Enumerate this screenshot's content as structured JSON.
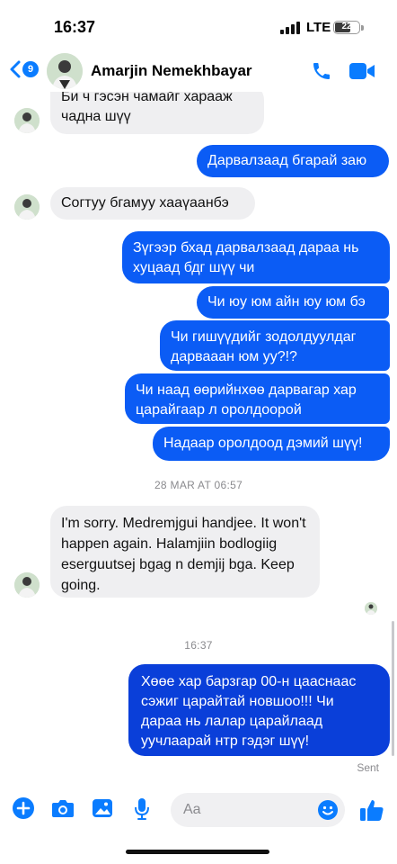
{
  "status_bar": {
    "time": "16:37",
    "network": "LTE",
    "battery": "22"
  },
  "header": {
    "back_count": "9",
    "contact_name": "Amarjin Nemekhbayar"
  },
  "messages": [
    {
      "side": "in",
      "text": "Би ч гэсэн чамайг харааж чадна шүү"
    },
    {
      "side": "out",
      "text": "Дарвалзаад бгарай заю"
    },
    {
      "side": "in",
      "text": "Согтуу бгамуу хааүаанбэ"
    },
    {
      "side": "out",
      "text": "Зүгээр бхад дарвалзаад дараа нь хуцаад бдг шүү чи"
    },
    {
      "side": "out",
      "text": "Чи юу юм айн юу юм бэ"
    },
    {
      "side": "out",
      "text": "Чи гишүүдийг зодолдуулдаг дарвааан юм уу?!?"
    },
    {
      "side": "out",
      "text": "Чи наад өөрийнхөө дарвагар хар царайгаар л оролдоорой"
    },
    {
      "side": "out",
      "text": "Надаар оролдоод дэмий шүү!"
    },
    {
      "side": "in",
      "text": "I'm sorry. Medremjgui handjee. It won't happen again. Halamjiin bodlogiig eserguutsej bgag n demjij bga. Keep going."
    },
    {
      "side": "out",
      "text": "Хөөе хар барзгар 00-н цааснаас сэжиг царайтай новшоо!!! Чи дараа нь лалар царайлаад уучлаарай нтр гэдэг шүү!"
    }
  ],
  "timestamps": {
    "first": "28 MAR AT 06:57",
    "second": "16:37"
  },
  "status": {
    "sent": "Sent"
  },
  "composer": {
    "placeholder": "Aa"
  },
  "colors": {
    "accent": "#0a7cff",
    "outgoing": "#0b5cf5",
    "incoming": "#efeff1"
  }
}
